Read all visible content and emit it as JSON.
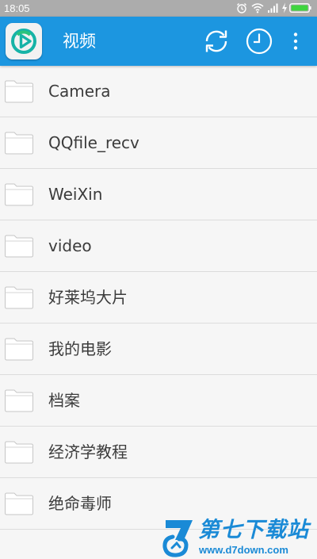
{
  "status_bar": {
    "time": "18:05",
    "icons": [
      "alarm-icon",
      "wifi-icon",
      "signal-icon",
      "charging-icon",
      "battery-icon"
    ],
    "battery_color": "#3fd43f"
  },
  "app_bar": {
    "title": "视频",
    "background": "#1c96e0",
    "actions": [
      "refresh-icon",
      "history-clock-icon",
      "more-vert-icon"
    ]
  },
  "folders": [
    {
      "name": "Camera"
    },
    {
      "name": "QQfile_recv"
    },
    {
      "name": "WeiXin"
    },
    {
      "name": "video"
    },
    {
      "name": "好莱坞大片"
    },
    {
      "name": "我的电影"
    },
    {
      "name": "档案"
    },
    {
      "name": "经济学教程"
    },
    {
      "name": "绝命毒师"
    }
  ],
  "watermark": {
    "title": "第七下载站",
    "url": "www.d7down.com",
    "color": "#1a8ad6"
  }
}
